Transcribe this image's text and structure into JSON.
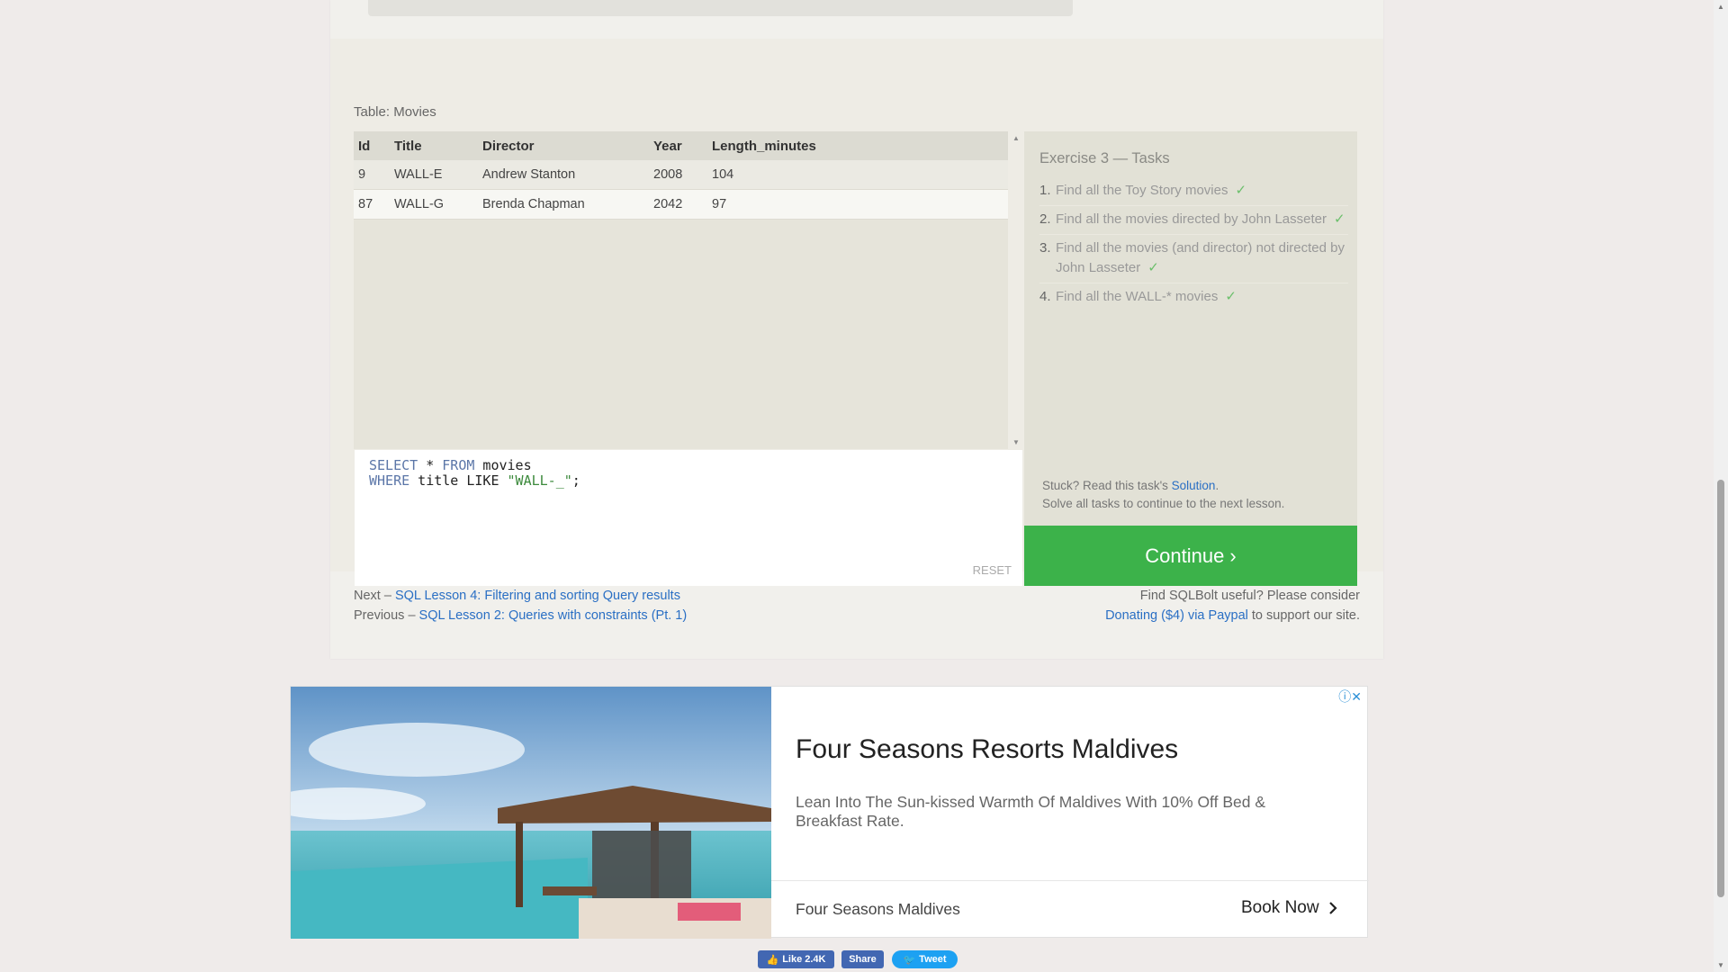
{
  "table": {
    "caption": "Table: Movies",
    "columns": [
      "Id",
      "Title",
      "Director",
      "Year",
      "Length_minutes"
    ],
    "rows": [
      [
        "9",
        "WALL-E",
        "Andrew Stanton",
        "2008",
        "104"
      ],
      [
        "87",
        "WALL-G",
        "Brenda Chapman",
        "2042",
        "97"
      ]
    ]
  },
  "editor": {
    "line1_kw1": "SELECT",
    "line1_rest": " * ",
    "line1_kw2": "FROM",
    "line1_end": " movies",
    "line2_kw": "WHERE",
    "line2_mid": " title LIKE ",
    "line2_str": "\"WALL-_\"",
    "line2_end": ";",
    "reset_label": "RESET"
  },
  "tasks": {
    "title": "Exercise 3 — Tasks",
    "check": "✓",
    "items": [
      {
        "num": "1.",
        "text": "Find all the Toy Story movies"
      },
      {
        "num": "2.",
        "text": "Find all the movies directed by John Lasseter"
      },
      {
        "num": "3.",
        "text": "Find all the movies (and director) not directed by John Lasseter"
      },
      {
        "num": "4.",
        "text": "Find all the WALL-* movies"
      }
    ],
    "stuck_prefix": "Stuck? Read this task's ",
    "solution_link": "Solution",
    "stuck_suffix": ".",
    "solve_all": "Solve all tasks to continue to the next lesson.",
    "continue_label": "Continue ›"
  },
  "footer": {
    "next_prefix": "Next – ",
    "next_link": "SQL Lesson 4: Filtering and sorting Query results",
    "prev_prefix": "Previous – ",
    "prev_link": "SQL Lesson 2: Queries with constraints (Pt. 1)",
    "donate_line1": "Find SQLBolt useful? Please consider",
    "donate_link": "Donating ($4) via Paypal",
    "donate_suffix": " to support our site."
  },
  "ad": {
    "title": "Four Seasons Resorts Maldives",
    "description": "Lean Into The Sun-kissed Warmth Of Maldives With 10% Off Bed & Breakfast Rate.",
    "brand": "Four Seasons Maldives",
    "cta": "Book Now",
    "icons": [
      "info-icon",
      "close-icon"
    ]
  },
  "social": {
    "like_label": "Like 2.4K",
    "share_label": "Share",
    "tweet_label": "Tweet"
  },
  "colors": {
    "continue": "#3cb24a",
    "link": "#2a6fc4",
    "check": "#6bbf6b"
  }
}
